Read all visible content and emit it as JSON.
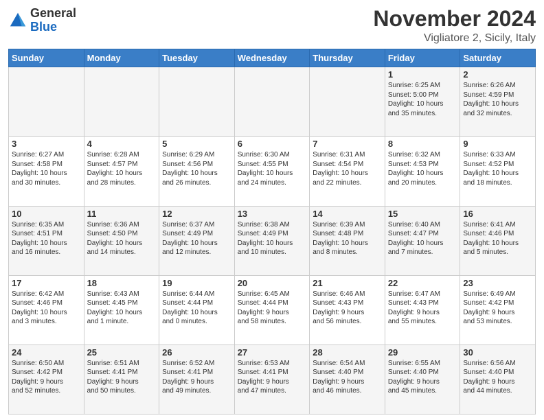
{
  "header": {
    "logo_general": "General",
    "logo_blue": "Blue",
    "title": "November 2024",
    "location": "Vigliatore 2, Sicily, Italy"
  },
  "weekdays": [
    "Sunday",
    "Monday",
    "Tuesday",
    "Wednesday",
    "Thursday",
    "Friday",
    "Saturday"
  ],
  "weeks": [
    [
      {
        "day": "",
        "info": ""
      },
      {
        "day": "",
        "info": ""
      },
      {
        "day": "",
        "info": ""
      },
      {
        "day": "",
        "info": ""
      },
      {
        "day": "",
        "info": ""
      },
      {
        "day": "1",
        "info": "Sunrise: 6:25 AM\nSunset: 5:00 PM\nDaylight: 10 hours\nand 35 minutes."
      },
      {
        "day": "2",
        "info": "Sunrise: 6:26 AM\nSunset: 4:59 PM\nDaylight: 10 hours\nand 32 minutes."
      }
    ],
    [
      {
        "day": "3",
        "info": "Sunrise: 6:27 AM\nSunset: 4:58 PM\nDaylight: 10 hours\nand 30 minutes."
      },
      {
        "day": "4",
        "info": "Sunrise: 6:28 AM\nSunset: 4:57 PM\nDaylight: 10 hours\nand 28 minutes."
      },
      {
        "day": "5",
        "info": "Sunrise: 6:29 AM\nSunset: 4:56 PM\nDaylight: 10 hours\nand 26 minutes."
      },
      {
        "day": "6",
        "info": "Sunrise: 6:30 AM\nSunset: 4:55 PM\nDaylight: 10 hours\nand 24 minutes."
      },
      {
        "day": "7",
        "info": "Sunrise: 6:31 AM\nSunset: 4:54 PM\nDaylight: 10 hours\nand 22 minutes."
      },
      {
        "day": "8",
        "info": "Sunrise: 6:32 AM\nSunset: 4:53 PM\nDaylight: 10 hours\nand 20 minutes."
      },
      {
        "day": "9",
        "info": "Sunrise: 6:33 AM\nSunset: 4:52 PM\nDaylight: 10 hours\nand 18 minutes."
      }
    ],
    [
      {
        "day": "10",
        "info": "Sunrise: 6:35 AM\nSunset: 4:51 PM\nDaylight: 10 hours\nand 16 minutes."
      },
      {
        "day": "11",
        "info": "Sunrise: 6:36 AM\nSunset: 4:50 PM\nDaylight: 10 hours\nand 14 minutes."
      },
      {
        "day": "12",
        "info": "Sunrise: 6:37 AM\nSunset: 4:49 PM\nDaylight: 10 hours\nand 12 minutes."
      },
      {
        "day": "13",
        "info": "Sunrise: 6:38 AM\nSunset: 4:49 PM\nDaylight: 10 hours\nand 10 minutes."
      },
      {
        "day": "14",
        "info": "Sunrise: 6:39 AM\nSunset: 4:48 PM\nDaylight: 10 hours\nand 8 minutes."
      },
      {
        "day": "15",
        "info": "Sunrise: 6:40 AM\nSunset: 4:47 PM\nDaylight: 10 hours\nand 7 minutes."
      },
      {
        "day": "16",
        "info": "Sunrise: 6:41 AM\nSunset: 4:46 PM\nDaylight: 10 hours\nand 5 minutes."
      }
    ],
    [
      {
        "day": "17",
        "info": "Sunrise: 6:42 AM\nSunset: 4:46 PM\nDaylight: 10 hours\nand 3 minutes."
      },
      {
        "day": "18",
        "info": "Sunrise: 6:43 AM\nSunset: 4:45 PM\nDaylight: 10 hours\nand 1 minute."
      },
      {
        "day": "19",
        "info": "Sunrise: 6:44 AM\nSunset: 4:44 PM\nDaylight: 10 hours\nand 0 minutes."
      },
      {
        "day": "20",
        "info": "Sunrise: 6:45 AM\nSunset: 4:44 PM\nDaylight: 9 hours\nand 58 minutes."
      },
      {
        "day": "21",
        "info": "Sunrise: 6:46 AM\nSunset: 4:43 PM\nDaylight: 9 hours\nand 56 minutes."
      },
      {
        "day": "22",
        "info": "Sunrise: 6:47 AM\nSunset: 4:43 PM\nDaylight: 9 hours\nand 55 minutes."
      },
      {
        "day": "23",
        "info": "Sunrise: 6:49 AM\nSunset: 4:42 PM\nDaylight: 9 hours\nand 53 minutes."
      }
    ],
    [
      {
        "day": "24",
        "info": "Sunrise: 6:50 AM\nSunset: 4:42 PM\nDaylight: 9 hours\nand 52 minutes."
      },
      {
        "day": "25",
        "info": "Sunrise: 6:51 AM\nSunset: 4:41 PM\nDaylight: 9 hours\nand 50 minutes."
      },
      {
        "day": "26",
        "info": "Sunrise: 6:52 AM\nSunset: 4:41 PM\nDaylight: 9 hours\nand 49 minutes."
      },
      {
        "day": "27",
        "info": "Sunrise: 6:53 AM\nSunset: 4:41 PM\nDaylight: 9 hours\nand 47 minutes."
      },
      {
        "day": "28",
        "info": "Sunrise: 6:54 AM\nSunset: 4:40 PM\nDaylight: 9 hours\nand 46 minutes."
      },
      {
        "day": "29",
        "info": "Sunrise: 6:55 AM\nSunset: 4:40 PM\nDaylight: 9 hours\nand 45 minutes."
      },
      {
        "day": "30",
        "info": "Sunrise: 6:56 AM\nSunset: 4:40 PM\nDaylight: 9 hours\nand 44 minutes."
      }
    ]
  ]
}
